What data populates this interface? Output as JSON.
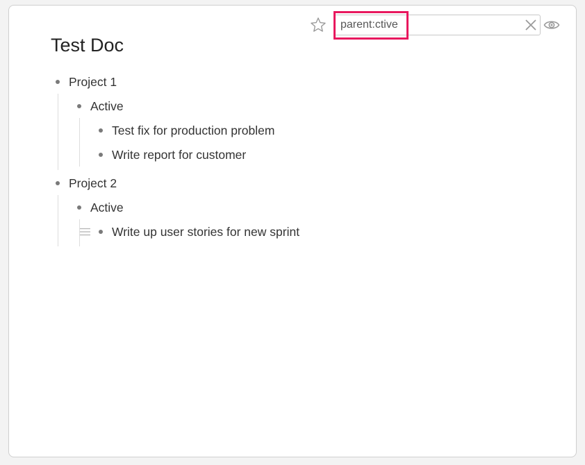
{
  "search": {
    "value": "parent:ctive"
  },
  "doc": {
    "title": "Test Doc",
    "items": [
      {
        "label": "Project 1",
        "children": [
          {
            "label": "Active",
            "children": [
              {
                "label": "Test fix for production problem"
              },
              {
                "label": "Write report for customer"
              }
            ]
          }
        ]
      },
      {
        "label": "Project 2",
        "children": [
          {
            "label": "Active",
            "children": [
              {
                "label": "Write up user stories for new sprint"
              }
            ]
          }
        ]
      }
    ]
  },
  "icons": {
    "star": "star-icon",
    "clear": "close-icon",
    "eye": "eye-icon",
    "handle": "drag-handle-icon"
  },
  "colors": {
    "highlight": "#e8185e",
    "bullet": "#7a7a7a"
  }
}
